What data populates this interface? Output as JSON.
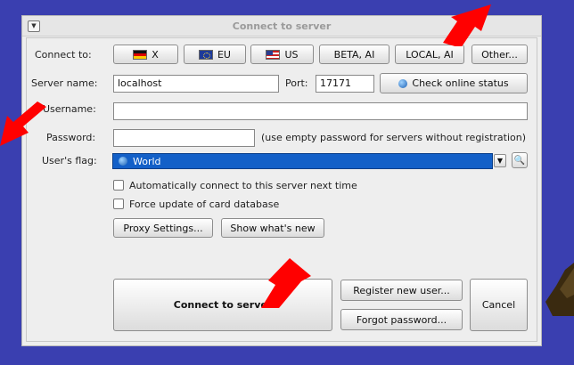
{
  "dialog": {
    "title": "Connect to server",
    "connect_to": {
      "label": "Connect to:",
      "servers": [
        {
          "label": "X",
          "flag": "de"
        },
        {
          "label": "EU",
          "flag": "eu"
        },
        {
          "label": "US",
          "flag": "us"
        },
        {
          "label": "BETA, AI"
        },
        {
          "label": "LOCAL, AI"
        },
        {
          "label": "Other..."
        }
      ]
    },
    "server": {
      "name_label": "Server name:",
      "name_value": "localhost",
      "port_label": "Port:",
      "port_value": "17171",
      "check_button": "Check online status"
    },
    "username": {
      "label": "Username:",
      "value": ""
    },
    "password": {
      "label": "Password:",
      "value": "",
      "hint": "(use empty password for servers without registration)"
    },
    "flag": {
      "label": "User's flag:",
      "selected": "World"
    },
    "options": {
      "auto_connect": {
        "label": "Automatically connect to this server next time",
        "checked": false
      },
      "force_update": {
        "label": "Force update of card database",
        "checked": false
      }
    },
    "buttons": {
      "proxy": "Proxy Settings...",
      "whats_new": "Show what's new",
      "connect": "Connect to server",
      "register": "Register new user...",
      "forgot": "Forgot password...",
      "cancel": "Cancel"
    }
  },
  "colors": {
    "desktop": "#3a3fb0",
    "selection": "#1360c8",
    "annotation_arrow": "#ff0000"
  }
}
